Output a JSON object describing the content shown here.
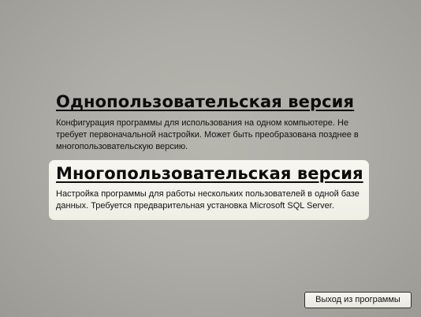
{
  "options": {
    "single_user": {
      "title": "Однопользовательская версия",
      "description": "Конфигурация программы для использования на одном компьютере. Не требует первоначальной настройки. Может быть преобразована позднее в многопользовательскую версию."
    },
    "multi_user": {
      "title": "Многопользовательская версия",
      "description": "Настройка программы для работы нескольких пользователей в одной базе данных. Требуется предварительная установка Microsoft SQL Server."
    }
  },
  "footer": {
    "exit_label": "Выход из программы"
  }
}
